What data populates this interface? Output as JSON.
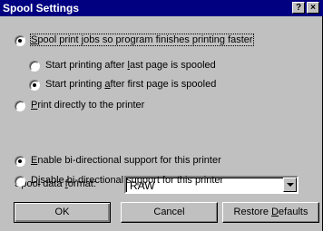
{
  "window": {
    "title": "Spool Settings",
    "help_button": "?",
    "close_button": "×"
  },
  "options": {
    "spool": {
      "pre": "",
      "accel": "S",
      "post": "pool print jobs so program finishes printing faster",
      "checked": true
    },
    "after_last": {
      "pre": "Start printing after ",
      "accel": "l",
      "post": "ast page is spooled",
      "checked": false
    },
    "after_first": {
      "pre": "Start printing ",
      "accel": "a",
      "post": "fter first page is spooled",
      "checked": true
    },
    "direct": {
      "pre": "",
      "accel": "P",
      "post": "rint directly to the printer",
      "checked": false
    }
  },
  "spool_format": {
    "label_pre": "Spool data ",
    "label_accel": "f",
    "label_post": "ormat:",
    "value": "RAW"
  },
  "bidi": {
    "enable": {
      "pre": "",
      "accel": "E",
      "post": "nable bi-directional support for this printer",
      "checked": true
    },
    "disable": {
      "pre": "D",
      "accel": "i",
      "post": "sable bi-directional support for this printer",
      "checked": false
    }
  },
  "buttons": {
    "ok": "OK",
    "cancel": "Cancel",
    "restore_pre": "Restore ",
    "restore_accel": "D",
    "restore_post": "efaults"
  }
}
